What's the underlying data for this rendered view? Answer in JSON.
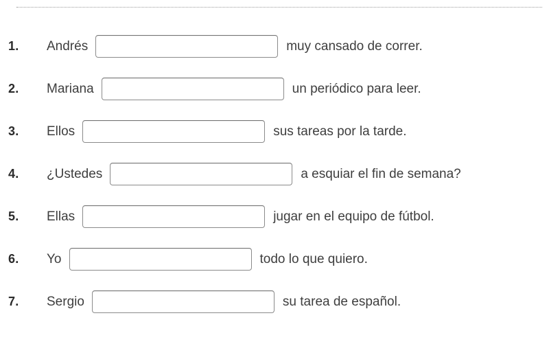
{
  "page": {
    "title": "Spanish verb conjugation fill-in-the-blank worksheet",
    "divider": "dotted-rule",
    "text_color": "#3e3e3e",
    "number_color": "#2b2b2b",
    "input_border_color": "#8a8a8a",
    "background": "#ffffff"
  },
  "exercises": [
    {
      "number": "1.",
      "pre": "Andrés",
      "input_value": "",
      "input_placeholder": "",
      "post": "muy cansado de correr."
    },
    {
      "number": "2.",
      "pre": "Mariana",
      "input_value": "",
      "input_placeholder": "",
      "post": "un periódico para leer."
    },
    {
      "number": "3.",
      "pre": "Ellos",
      "input_value": "",
      "input_placeholder": "",
      "post": "sus tareas por la tarde."
    },
    {
      "number": "4.",
      "pre": "¿Ustedes",
      "input_value": "",
      "input_placeholder": "",
      "post": "a esquiar el fin de semana?"
    },
    {
      "number": "5.",
      "pre": "Ellas",
      "input_value": "",
      "input_placeholder": "",
      "post": "jugar en el equipo de fútbol."
    },
    {
      "number": "6.",
      "pre": "Yo",
      "input_value": "",
      "input_placeholder": "",
      "post": "todo lo que quiero."
    },
    {
      "number": "7.",
      "pre": "Sergio",
      "input_value": "",
      "input_placeholder": "",
      "post": "su tarea de español."
    }
  ]
}
